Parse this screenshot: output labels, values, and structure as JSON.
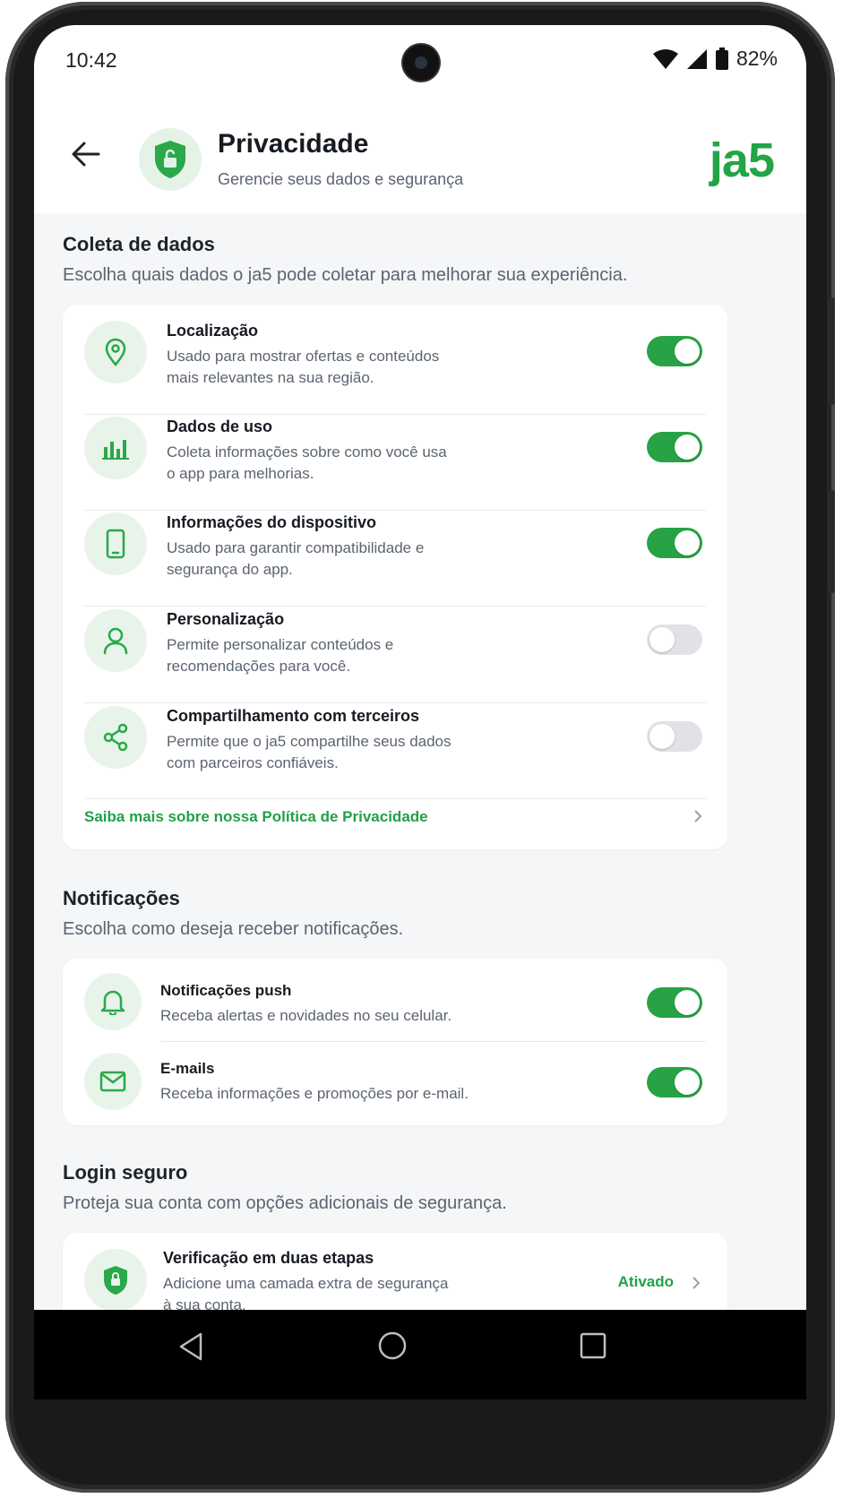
{
  "status_bar": {
    "time": "10:42",
    "battery": "82%"
  },
  "header": {
    "title": "Privacidade",
    "subtitle": "Gerencie seus dados e segurança",
    "logo": "ja5"
  },
  "data_collection": {
    "title": "Coleta de dados",
    "description": "Escolha quais dados o ja5 pode coletar para melhorar sua experiência.",
    "items": [
      {
        "title": "Localização",
        "desc_line1": "Usado para mostrar ofertas e conteúdos",
        "desc_line2": "mais relevantes na sua região.",
        "icon": "location-pin-icon",
        "enabled": true
      },
      {
        "title": "Dados de uso",
        "desc_line1": "Coleta informações sobre como você usa",
        "desc_line2": "o app para melhorias.",
        "icon": "bar-chart-icon",
        "enabled": true
      },
      {
        "title": "Informações do dispositivo",
        "desc_line1": "Usado para garantir compatibilidade e",
        "desc_line2": "segurança do app.",
        "icon": "smartphone-icon",
        "enabled": true
      },
      {
        "title": "Personalização",
        "desc_line1": "Permite personalizar conteúdos e",
        "desc_line2": "recomendações para você.",
        "icon": "user-icon",
        "enabled": false
      },
      {
        "title": "Compartilhamento com terceiros",
        "desc_line1": "Permite que o ja5 compartilhe seus dados",
        "desc_line2": "com parceiros confiáveis.",
        "icon": "share-icon",
        "enabled": false
      }
    ],
    "policy_link": "Saiba mais sobre nossa Política de Privacidade"
  },
  "notifications": {
    "title": "Notificações",
    "description": "Escolha como deseja receber notificações.",
    "items": [
      {
        "title": "Notificações push",
        "desc": "Receba alertas e novidades no seu celular.",
        "icon": "bell-icon",
        "enabled": true
      },
      {
        "title": "E-mails",
        "desc": "Receba informações e promoções por e-mail.",
        "icon": "mail-icon",
        "enabled": true
      }
    ]
  },
  "secure_login": {
    "title": "Login seguro",
    "description": "Proteja sua conta com opções adicionais de segurança.",
    "two_factor": {
      "title": "Verificação em duas etapas",
      "desc_line1": "Adicione uma camada extra de segurança",
      "desc_line2": "à sua conta.",
      "status": "Ativado",
      "icon": "shield-lock-icon"
    }
  },
  "colors": {
    "accent": "#27a345",
    "icon_bg": "#e8f4ea",
    "toggle_off": "#e0e2e5"
  }
}
